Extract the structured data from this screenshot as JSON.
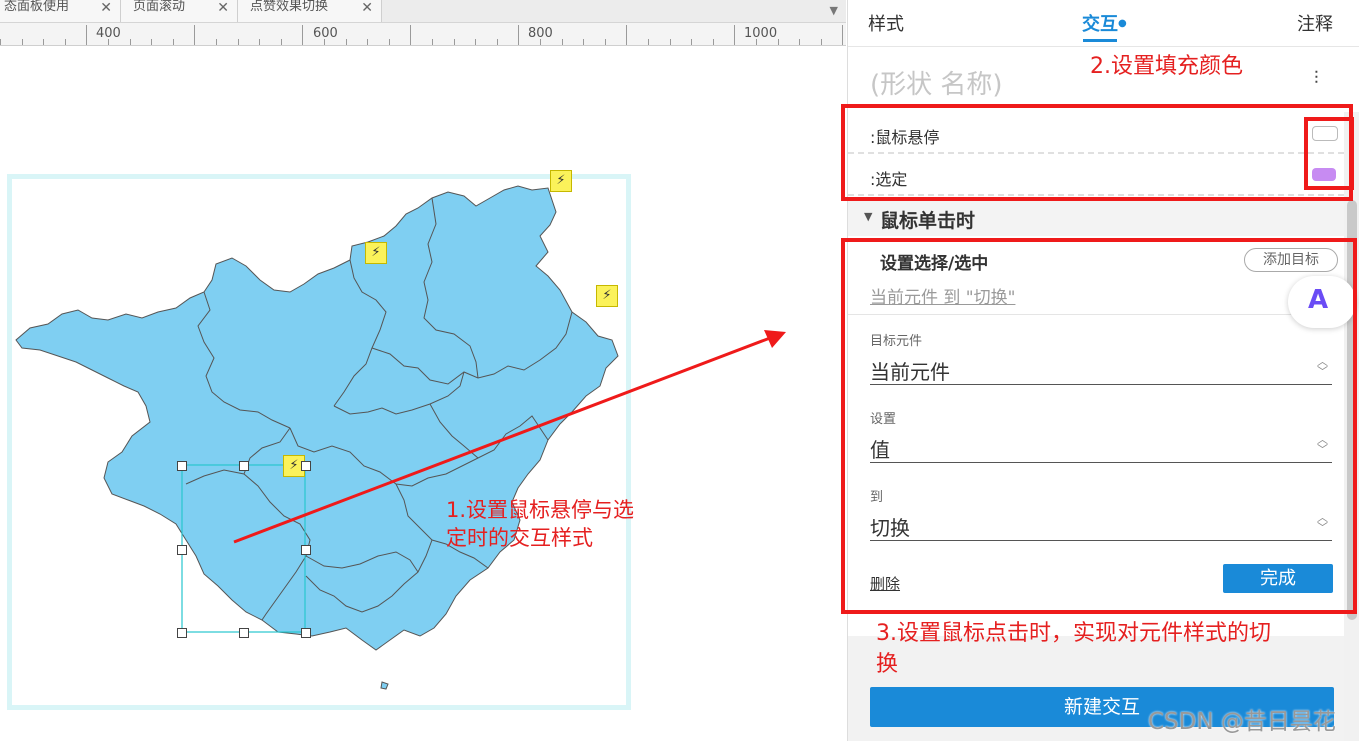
{
  "tabs": [
    {
      "label": "态面板使用",
      "close": "✕"
    },
    {
      "label": "页面滚动",
      "close": "✕"
    },
    {
      "label": "点赞效果切换",
      "close": "✕"
    }
  ],
  "ruler": {
    "labels": [
      "400",
      "600",
      "800",
      "1000"
    ]
  },
  "canvas": {
    "bolt_icon": "⚡",
    "annotation_1": {
      "line1": "1.设置鼠标悬停与选",
      "line2": "定时的交互样式"
    },
    "map_color": "#7fcff2"
  },
  "panel": {
    "tabs": {
      "style": "样式",
      "interaction": "交互",
      "interaction_dot": "●",
      "notes": "注释"
    },
    "shape_name": "(形状 名称)",
    "settings_icon": "⫶",
    "annotation_2": "2.设置填充颜色",
    "states": [
      {
        "label": ":鼠标悬停",
        "color": "#ffffff"
      },
      {
        "label": ":选定",
        "color": "#c78bf2"
      }
    ],
    "event": {
      "caret": "▼",
      "title": "鼠标单击时"
    },
    "action": {
      "title": "设置选择/选中",
      "add_target": "添加目标",
      "description": "当前元件 到 \"切换\"",
      "fields": [
        {
          "label": "目标元件",
          "value": "当前元件"
        },
        {
          "label": "设置",
          "value": "值"
        },
        {
          "label": "到",
          "value": "切换"
        }
      ],
      "spinner": "⌃⌄",
      "delete": "删除",
      "done": "完成"
    },
    "annotation_3": {
      "line1": "3.设置鼠标点击时，实现对元件样式的切",
      "line2": "换"
    },
    "new_interaction": "新建交互",
    "assistant_icon": "A"
  },
  "watermark": "CSDN @昔日昙花",
  "colors": {
    "accent": "#1a8ad8",
    "annotation_red": "#e52020",
    "box_red": "#ef1a1a"
  }
}
